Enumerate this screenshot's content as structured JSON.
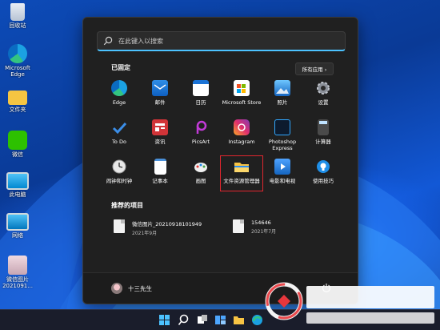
{
  "desktop": {
    "icons": [
      {
        "label": "回收站",
        "icon": "recycle-bin-icon"
      },
      {
        "label": "Microsoft Edge",
        "icon": "edge-icon"
      },
      {
        "label": "文件夹",
        "icon": "folder-icon"
      },
      {
        "label": "微信",
        "icon": "wechat-icon"
      },
      {
        "label": "此电脑",
        "icon": "computer-icon"
      },
      {
        "label": "网络",
        "icon": "network-icon"
      },
      {
        "label": "微信图片 2021091...",
        "icon": "image-file-icon"
      }
    ]
  },
  "start_menu": {
    "search_placeholder": "在此键入以搜索",
    "pinned_title": "已固定",
    "all_apps_label": "所有应用 ›",
    "pinned_apps": [
      {
        "label": "Edge",
        "icon": "edge-icon"
      },
      {
        "label": "邮件",
        "icon": "mail-icon"
      },
      {
        "label": "日历",
        "icon": "calendar-icon"
      },
      {
        "label": "Microsoft Store",
        "icon": "store-icon"
      },
      {
        "label": "照片",
        "icon": "photos-icon"
      },
      {
        "label": "设置",
        "icon": "settings-gear-icon"
      },
      {
        "label": "To Do",
        "icon": "todo-check-icon"
      },
      {
        "label": "资讯",
        "icon": "news-icon"
      },
      {
        "label": "PicsArt",
        "icon": "picsart-icon"
      },
      {
        "label": "Instagram",
        "icon": "instagram-icon"
      },
      {
        "label": "Photoshop Express",
        "icon": "photoshop-icon"
      },
      {
        "label": "计算器",
        "icon": "calculator-icon"
      },
      {
        "label": "闹钟和时钟",
        "icon": "clock-icon"
      },
      {
        "label": "记事本",
        "icon": "notepad-icon"
      },
      {
        "label": "画图",
        "icon": "paint-icon"
      },
      {
        "label": "文件资源管理器",
        "icon": "file-explorer-icon",
        "highlighted": true
      },
      {
        "label": "电影和电视",
        "icon": "movies-tv-icon"
      },
      {
        "label": "使用技巧",
        "icon": "tips-icon"
      }
    ],
    "recommended_title": "推荐的项目",
    "recommended": [
      {
        "name": "微信图片_20210918101949",
        "date": "2021年9月"
      },
      {
        "name": "154646",
        "date": "2021年7月"
      }
    ],
    "user_name": "十三先生"
  },
  "colors": {
    "accent": "#4cc2ff",
    "highlight_box": "#e0262e",
    "menu_bg": "#202020"
  }
}
